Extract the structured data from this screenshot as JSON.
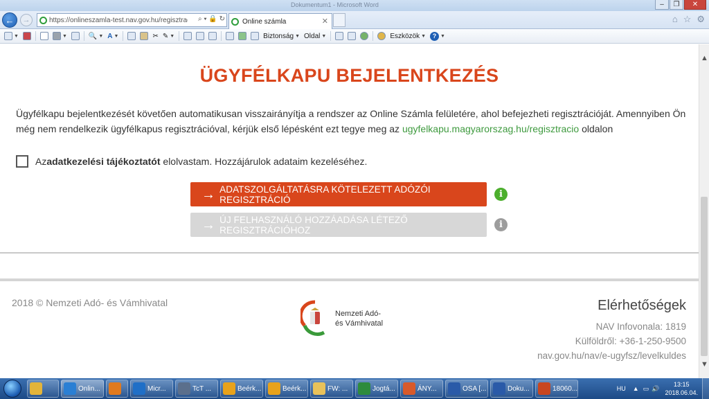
{
  "browser": {
    "window_title": "Dokumentum1 - Microsoft Word",
    "address_url": "https://onlineszamla-test.nav.gov.hu/regisztracio/s",
    "tab_title": "Online számla",
    "command_bar": {
      "safety_label": "Biztonság",
      "page_label": "Oldal",
      "tools_label": "Eszközök"
    }
  },
  "page": {
    "heading": "ÜGYFÉLKAPU BEJELENTKEZÉS",
    "intro_text": "Ügyfélkapu bejelentkezését követően automatikusan visszairányítja a rendszer az Online Számla felületére, ahol befejezheti regisztrációját. Amennyiben Ön még nem rendelkezik ügyfélkapus regisztrációval, kérjük első lépésként ezt tegye meg az ",
    "intro_link": "ugyfelkapu.magyarorszag.hu/regisztracio",
    "intro_suffix": " oldalon",
    "consent": {
      "prefix": "Az ",
      "bold": "adatkezelési tájékoztatót",
      "suffix": " elolvastam. Hozzájárulok adataim kezeléséhez.",
      "checked": false
    },
    "buttons": {
      "primary_label": "ADATSZOLGÁLTATÁSRA KÖTELEZETT ADÓZÓI REGISZTRÁCIÓ",
      "secondary_label": "ÚJ FELHASZNÁLÓ HOZZÁADÁSA LÉTEZŐ REGISZTRÁCIÓHOZ"
    }
  },
  "footer": {
    "copyright": "2018 © Nemzeti Adó- és Vámhivatal",
    "logo_line1": "Nemzeti Adó-",
    "logo_line2": "és Vámhivatal",
    "contact_title": "Elérhetőségek",
    "infovonal": "NAV Infovonala: 1819",
    "kulfold": "Külföldről: +36-1-250-9500",
    "link": "nav.gov.hu/nav/e-ugyfsz/levelkuldes"
  },
  "taskbar": {
    "items": [
      {
        "label": "",
        "icon": "folder-icon",
        "color": "#e3b43a"
      },
      {
        "label": "Onlin...",
        "icon": "internet-explorer-icon",
        "color": "#2a7fd4"
      },
      {
        "label": "",
        "icon": "media-player-icon",
        "color": "#e07a1f"
      },
      {
        "label": "Micr...",
        "icon": "lync-icon",
        "color": "#1f6fc7"
      },
      {
        "label": "TcT ...",
        "icon": "phone-icon",
        "color": "#5b6f8c"
      },
      {
        "label": "Beérk...",
        "icon": "outlook-icon",
        "color": "#e8a21b"
      },
      {
        "label": "Beérk...",
        "icon": "outlook-icon",
        "color": "#e8a21b"
      },
      {
        "label": "FW: ...",
        "icon": "mail-icon",
        "color": "#e9c25a"
      },
      {
        "label": "Jogtá...",
        "icon": "app-icon",
        "color": "#2e8b3d"
      },
      {
        "label": "ÁNY...",
        "icon": "java-icon",
        "color": "#d85a2a"
      },
      {
        "label": "OSA [...",
        "icon": "word-icon",
        "color": "#2a5aa8"
      },
      {
        "label": "Doku...",
        "icon": "word-icon",
        "color": "#2a5aa8"
      },
      {
        "label": "18060...",
        "icon": "powerpoint-icon",
        "color": "#c8461f"
      }
    ],
    "lang": "HU",
    "time": "13:15",
    "date": "2018.06.04."
  },
  "colors": {
    "brand": "#d9461c",
    "link": "#3e9a3e",
    "info_green": "#4caf2d",
    "disabled": "#d7d7d7"
  }
}
